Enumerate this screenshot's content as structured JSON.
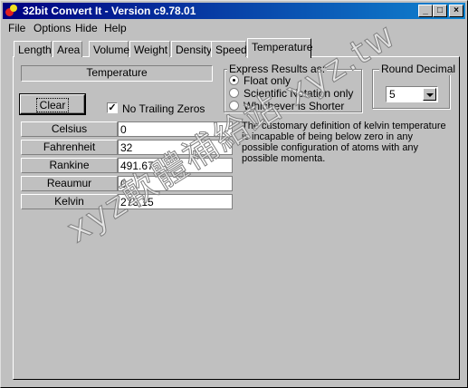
{
  "window": {
    "title": "32bit Convert It - Version c9.78.01"
  },
  "menu": [
    {
      "label": "File"
    },
    {
      "label": "Options"
    },
    {
      "label": "Hide"
    },
    {
      "label": "Help"
    }
  ],
  "tabs": [
    "Length",
    "Area",
    "Volume",
    "Weight",
    "Density",
    "Speed",
    "Temperature"
  ],
  "active_tab": "Temperature",
  "panel": {
    "category_label": "Temperature",
    "clear_label": "Clear",
    "no_trailing_zeros_label": "No Trailing Zeros",
    "no_trailing_zeros_checked": true,
    "rows": [
      {
        "unit": "Celsius",
        "value": "0"
      },
      {
        "unit": "Fahrenheit",
        "value": "32"
      },
      {
        "unit": "Rankine",
        "value": "491.67"
      },
      {
        "unit": "Reaumur",
        "value": "0"
      },
      {
        "unit": "Kelvin",
        "value": "273.15"
      }
    ],
    "express_group_title": "Express Results as:",
    "express_options": [
      {
        "label": "Float only",
        "selected": true
      },
      {
        "label": "Scientific Notation only",
        "selected": false
      },
      {
        "label": "Whichever is Shorter",
        "selected": false
      }
    ],
    "round_group_title": "Round Decimal",
    "round_value": "5",
    "description": "The customary definition of kelvin temperature is incapable of being below zero in any possible configuration of atoms with any possible momenta."
  },
  "watermark": "xyz軟體補給站 xyz.tw"
}
